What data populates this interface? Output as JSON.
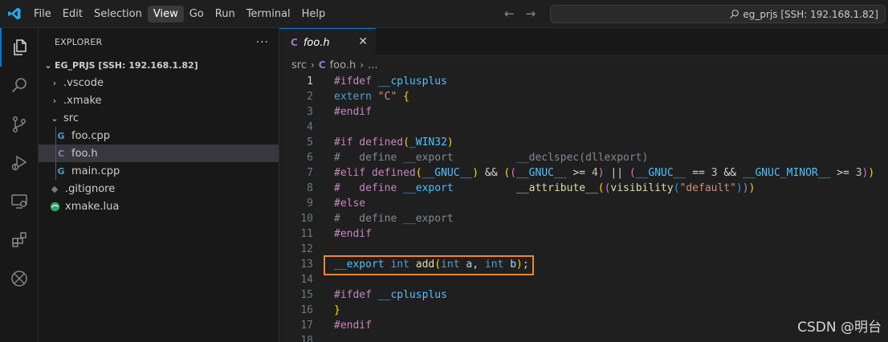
{
  "menu": [
    "File",
    "Edit",
    "Selection",
    "View",
    "Go",
    "Run",
    "Terminal",
    "Help"
  ],
  "menu_active": "View",
  "command_center": {
    "text": "eg_prjs [SSH: 192.168.1.82]"
  },
  "activity_icons": [
    "files-icon",
    "search-icon",
    "source-control-icon",
    "run-debug-icon",
    "remote-explorer-icon",
    "extensions-icon",
    "xmake-icon"
  ],
  "sidebar": {
    "title": "EXPLORER",
    "more": "···",
    "section": "EG_PRJS [SSH: 192.168.1.82]",
    "items": [
      {
        "label": ".vscode",
        "type": "folder",
        "expanded": false,
        "depth": 1
      },
      {
        "label": ".xmake",
        "type": "folder",
        "expanded": false,
        "depth": 1
      },
      {
        "label": "src",
        "type": "folder",
        "expanded": true,
        "depth": 1
      },
      {
        "label": "foo.cpp",
        "type": "cpp",
        "depth": 2
      },
      {
        "label": "foo.h",
        "type": "c-header",
        "depth": 2,
        "selected": true
      },
      {
        "label": "main.cpp",
        "type": "cpp",
        "depth": 2
      },
      {
        "label": ".gitignore",
        "type": "gitignore",
        "depth": 1
      },
      {
        "label": "xmake.lua",
        "type": "lua",
        "depth": 1
      }
    ]
  },
  "editor": {
    "tab": {
      "label": "foo.h",
      "icon": "C"
    },
    "breadcrumb": {
      "folder": "src",
      "file": "foo.h",
      "icon": "C",
      "more": "..."
    },
    "current_line": 1,
    "highlighted_line": 13,
    "lines": [
      [
        [
          "pp",
          "#ifdef "
        ],
        [
          "m",
          "__cplusplus"
        ]
      ],
      [
        [
          "k",
          "extern "
        ],
        [
          "s",
          "\"C\" "
        ],
        [
          "b1",
          "{"
        ]
      ],
      [
        [
          "pp",
          "#endif"
        ]
      ],
      [],
      [
        [
          "pp",
          "#if "
        ],
        [
          "pp",
          "defined"
        ],
        [
          "b1",
          "("
        ],
        [
          "m",
          "_WIN32"
        ],
        [
          "b1",
          ")"
        ]
      ],
      [
        [
          "dim",
          "#   define __export          __declspec(dllexport)"
        ]
      ],
      [
        [
          "pp",
          "#elif "
        ],
        [
          "pp",
          "defined"
        ],
        [
          "b1",
          "("
        ],
        [
          "m",
          "__GNUC__"
        ],
        [
          "b1",
          ")"
        ],
        [
          "o",
          " && "
        ],
        [
          "b1",
          "("
        ],
        [
          "b2",
          "("
        ],
        [
          "m",
          "__GNUC__"
        ],
        [
          "o",
          " >= "
        ],
        [
          "n",
          "4"
        ],
        [
          "b2",
          ")"
        ],
        [
          "o",
          " || "
        ],
        [
          "b2",
          "("
        ],
        [
          "m",
          "__GNUC__"
        ],
        [
          "o",
          " == "
        ],
        [
          "n",
          "3"
        ],
        [
          "o",
          " && "
        ],
        [
          "m",
          "__GNUC_MINOR__"
        ],
        [
          "o",
          " >= "
        ],
        [
          "n",
          "3"
        ],
        [
          "b2",
          ")"
        ],
        [
          "b1",
          ")"
        ]
      ],
      [
        [
          "pp",
          "#   define "
        ],
        [
          "m",
          "__export"
        ],
        [
          "o",
          "          "
        ],
        [
          "f",
          "__attribute__"
        ],
        [
          "b1",
          "("
        ],
        [
          "b2",
          "("
        ],
        [
          "f",
          "visibility"
        ],
        [
          "b3",
          "("
        ],
        [
          "s",
          "\"default\""
        ],
        [
          "b3",
          ")"
        ],
        [
          "b2",
          ")"
        ],
        [
          "b1",
          ")"
        ]
      ],
      [
        [
          "pp",
          "#else"
        ]
      ],
      [
        [
          "dim",
          "#   define __export"
        ]
      ],
      [
        [
          "pp",
          "#endif"
        ]
      ],
      [],
      [
        [
          "m",
          "__export "
        ],
        [
          "k",
          "int "
        ],
        [
          "f",
          "add"
        ],
        [
          "b1",
          "("
        ],
        [
          "k",
          "int "
        ],
        [
          "p",
          "a"
        ],
        [
          "o",
          ", "
        ],
        [
          "k",
          "int "
        ],
        [
          "p",
          "b"
        ],
        [
          "b1",
          ")"
        ],
        [
          "o",
          ";"
        ]
      ],
      [],
      [
        [
          "pp",
          "#ifdef "
        ],
        [
          "m",
          "__cplusplus"
        ]
      ],
      [
        [
          "b1",
          "}"
        ]
      ],
      [
        [
          "pp",
          "#endif"
        ]
      ],
      []
    ]
  },
  "watermark": "CSDN @明台"
}
